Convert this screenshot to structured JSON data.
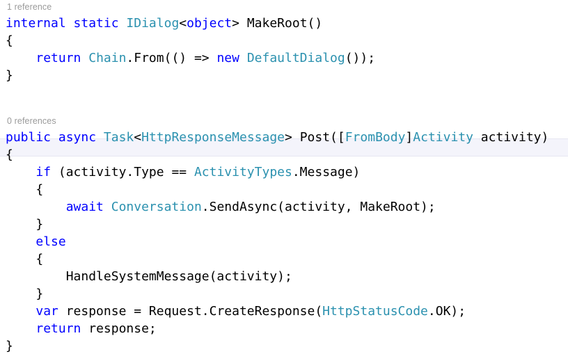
{
  "editor": {
    "language": "csharp",
    "background_color": "#ffffff",
    "colors": {
      "keyword": "#0000ff",
      "type": "#2b91af",
      "plain": "#000000",
      "codelens": "#9a9a9a",
      "current_line_highlight": "#f4f4fb",
      "current_line_border": "#e7e7f2"
    }
  },
  "codelens": {
    "make_root": "1 reference",
    "post": "0 references"
  },
  "code": {
    "l1": {
      "t1": "internal",
      "t2": " ",
      "t3": "static",
      "t4": " ",
      "t5": "IDialog",
      "t6": "<",
      "t7": "object",
      "t8": "> MakeRoot()"
    },
    "l2": {
      "t1": "{"
    },
    "l3": {
      "t1": "    ",
      "t2": "return",
      "t3": " ",
      "t4": "Chain",
      "t5": ".From(() => ",
      "t6": "new",
      "t7": " ",
      "t8": "DefaultDialog",
      "t9": "());"
    },
    "l4": {
      "t1": "}"
    },
    "l5": {
      "t1": "public",
      "t2": " ",
      "t3": "async",
      "t4": " ",
      "t5": "Task",
      "t6": "<",
      "t7": "HttpResponseMessage",
      "t8": "> Post([",
      "t9": "FromBody",
      "t10": "]",
      "t11": "Activity",
      "t12": " activity)"
    },
    "l6": {
      "t1": "{"
    },
    "l7": {
      "t1": "    ",
      "t2": "if",
      "t3": " (activity.Type == ",
      "t4": "ActivityTypes",
      "t5": ".Message)"
    },
    "l8": {
      "t1": "    {"
    },
    "l9": {
      "t1": "        ",
      "t2": "await",
      "t3": " ",
      "t4": "Conversation",
      "t5": ".SendAsync(activity, MakeRoot);"
    },
    "l10": {
      "t1": "    }"
    },
    "l11": {
      "t1": "    ",
      "t2": "else"
    },
    "l12": {
      "t1": "    {"
    },
    "l13": {
      "t1": "        HandleSystemMessage(activity);"
    },
    "l14": {
      "t1": "    }"
    },
    "l15": {
      "t1": "    ",
      "t2": "var",
      "t3": " response = Request.CreateResponse(",
      "t4": "HttpStatusCode",
      "t5": ".OK);"
    },
    "l16": {
      "t1": "    ",
      "t2": "return",
      "t3": " response;"
    },
    "l17": {
      "t1": "}"
    }
  }
}
